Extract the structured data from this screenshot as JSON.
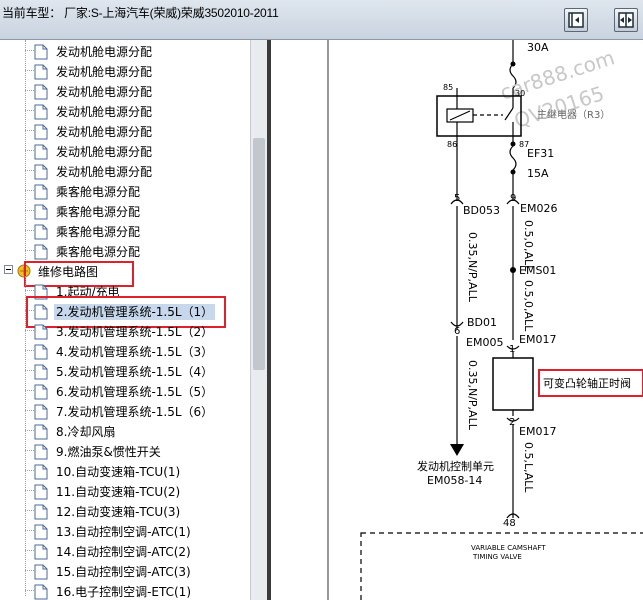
{
  "header": {
    "title": "当前车型：  厂家:S-上海汽车(荣威)荣威3502010-2011",
    "btn_left_icon": "collapse-left-icon",
    "btn_right_icon": "expand-right-icon"
  },
  "tree": {
    "items_top": [
      "发动机舱电源分配",
      "发动机舱电源分配",
      "发动机舱电源分配",
      "发动机舱电源分配",
      "发动机舱电源分配",
      "发动机舱电源分配",
      "发动机舱电源分配",
      "乘客舱电源分配",
      "乘客舱电源分配",
      "乘客舱电源分配",
      "乘客舱电源分配"
    ],
    "folder_label": "维修电路图",
    "items_bottom": [
      "1.起动/充电",
      "2.发动机管理系统-1.5L（1）",
      "3.发动机管理系统-1.5L（2）",
      "4.发动机管理系统-1.5L（3）",
      "5.发动机管理系统-1.5L（4）",
      "6.发动机管理系统-1.5L（5）",
      "7.发动机管理系统-1.5L（6）",
      "8.冷却风扇",
      "9.燃油泵&惯性开关",
      "10.自动变速箱-TCU(1)",
      "11.自动变速箱-TCU(2)",
      "12.自动变速箱-TCU(3)",
      "13.自动控制空调-ATC(1)",
      "14.自动控制空调-ATC(2)",
      "15.自动控制空调-ATC(3)",
      "16.电子控制空调-ETC(1)"
    ],
    "selected_index": 1
  },
  "diagram": {
    "fuse_30a": "30A",
    "watermark1": "car888.com",
    "watermark2": "QV20165",
    "relay_pin85": "85",
    "relay_pin30": "30",
    "relay_pin86": "86",
    "relay_pin87": "87",
    "relay_label": "主继电器（R3）",
    "fuse_ef31": "EF31",
    "fuse_15a": "15A",
    "pin5": "5",
    "pin9": "9",
    "conn_bd053": "BD053",
    "conn_em026": "EM026",
    "wire_left_1": "0.35,N/P,ALL",
    "wire_right_1": "0.5,0,ALL",
    "splice_ems01": "EMS01",
    "wire_right_2": "0.5,0,ALL",
    "conn_bd01": "BD01",
    "pin6": "6",
    "conn_em005": "EM005",
    "pin1": "1",
    "conn_em017_top": "EM017",
    "wire_left_2": "0.35,N/P,ALL",
    "valve_label": "可变凸轮轴正时阀",
    "pin2": "2",
    "conn_em017_bot": "EM017",
    "wire_right_3": "0.5,L,ALL",
    "ecu_label": "发动机控制单元",
    "ecu_conn": "EM058-14",
    "pin48": "48",
    "box_label1": "VARIABLE CAMSHAFT",
    "box_label2": "TIMING VALVE",
    "red": "#e0202a"
  }
}
